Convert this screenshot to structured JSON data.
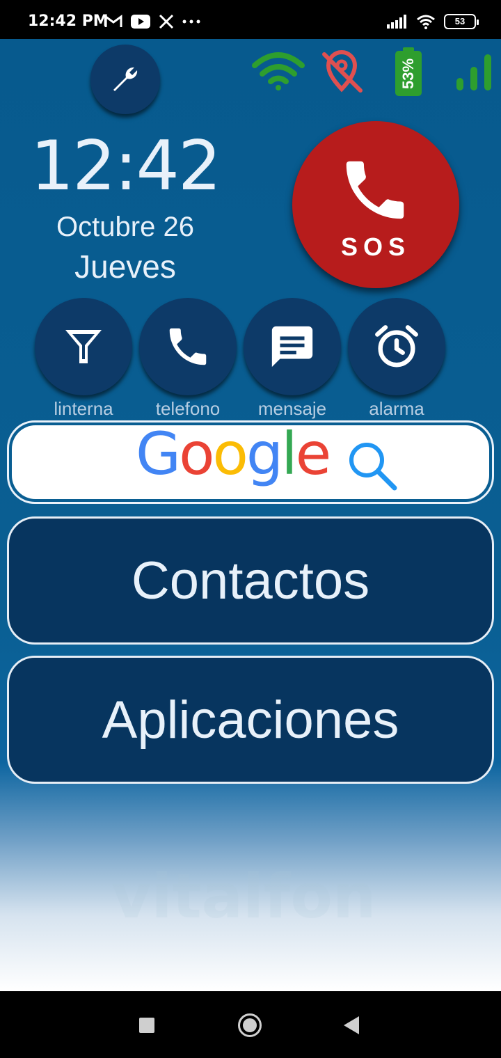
{
  "status_bar": {
    "time": "12:42 PM",
    "battery_level": "53",
    "icons": [
      "gmail-icon",
      "youtube-icon",
      "x-icon",
      "more-icon",
      "signal-icon",
      "wifi-icon",
      "battery-icon"
    ]
  },
  "header": {
    "settings_icon": "wrench-icon",
    "wifi_indicator": "wifi-icon",
    "location_off_indicator": "location-off-icon",
    "battery_percent": "53%",
    "signal_indicator": "signal-icon"
  },
  "clock": {
    "time": "12:42",
    "date": "Octubre 26",
    "weekday": "Jueves"
  },
  "sos": {
    "label": "SOS",
    "color": "#b71c1c"
  },
  "quick_actions": [
    {
      "label": "linterna",
      "icon": "flashlight-icon"
    },
    {
      "label": "telefono",
      "icon": "phone-icon"
    },
    {
      "label": "mensaje",
      "icon": "message-icon"
    },
    {
      "label": "alarma",
      "icon": "alarm-icon"
    }
  ],
  "search": {
    "logo": "Google",
    "icon": "search-icon"
  },
  "main_buttons": {
    "contacts": "Contactos",
    "apps": "Aplicaciones"
  },
  "watermark": "vitalfon",
  "colors": {
    "background": "#075a8e",
    "button": "#0d3a68",
    "accent_green": "#2e9e2e",
    "sos_red": "#b71c1c"
  }
}
